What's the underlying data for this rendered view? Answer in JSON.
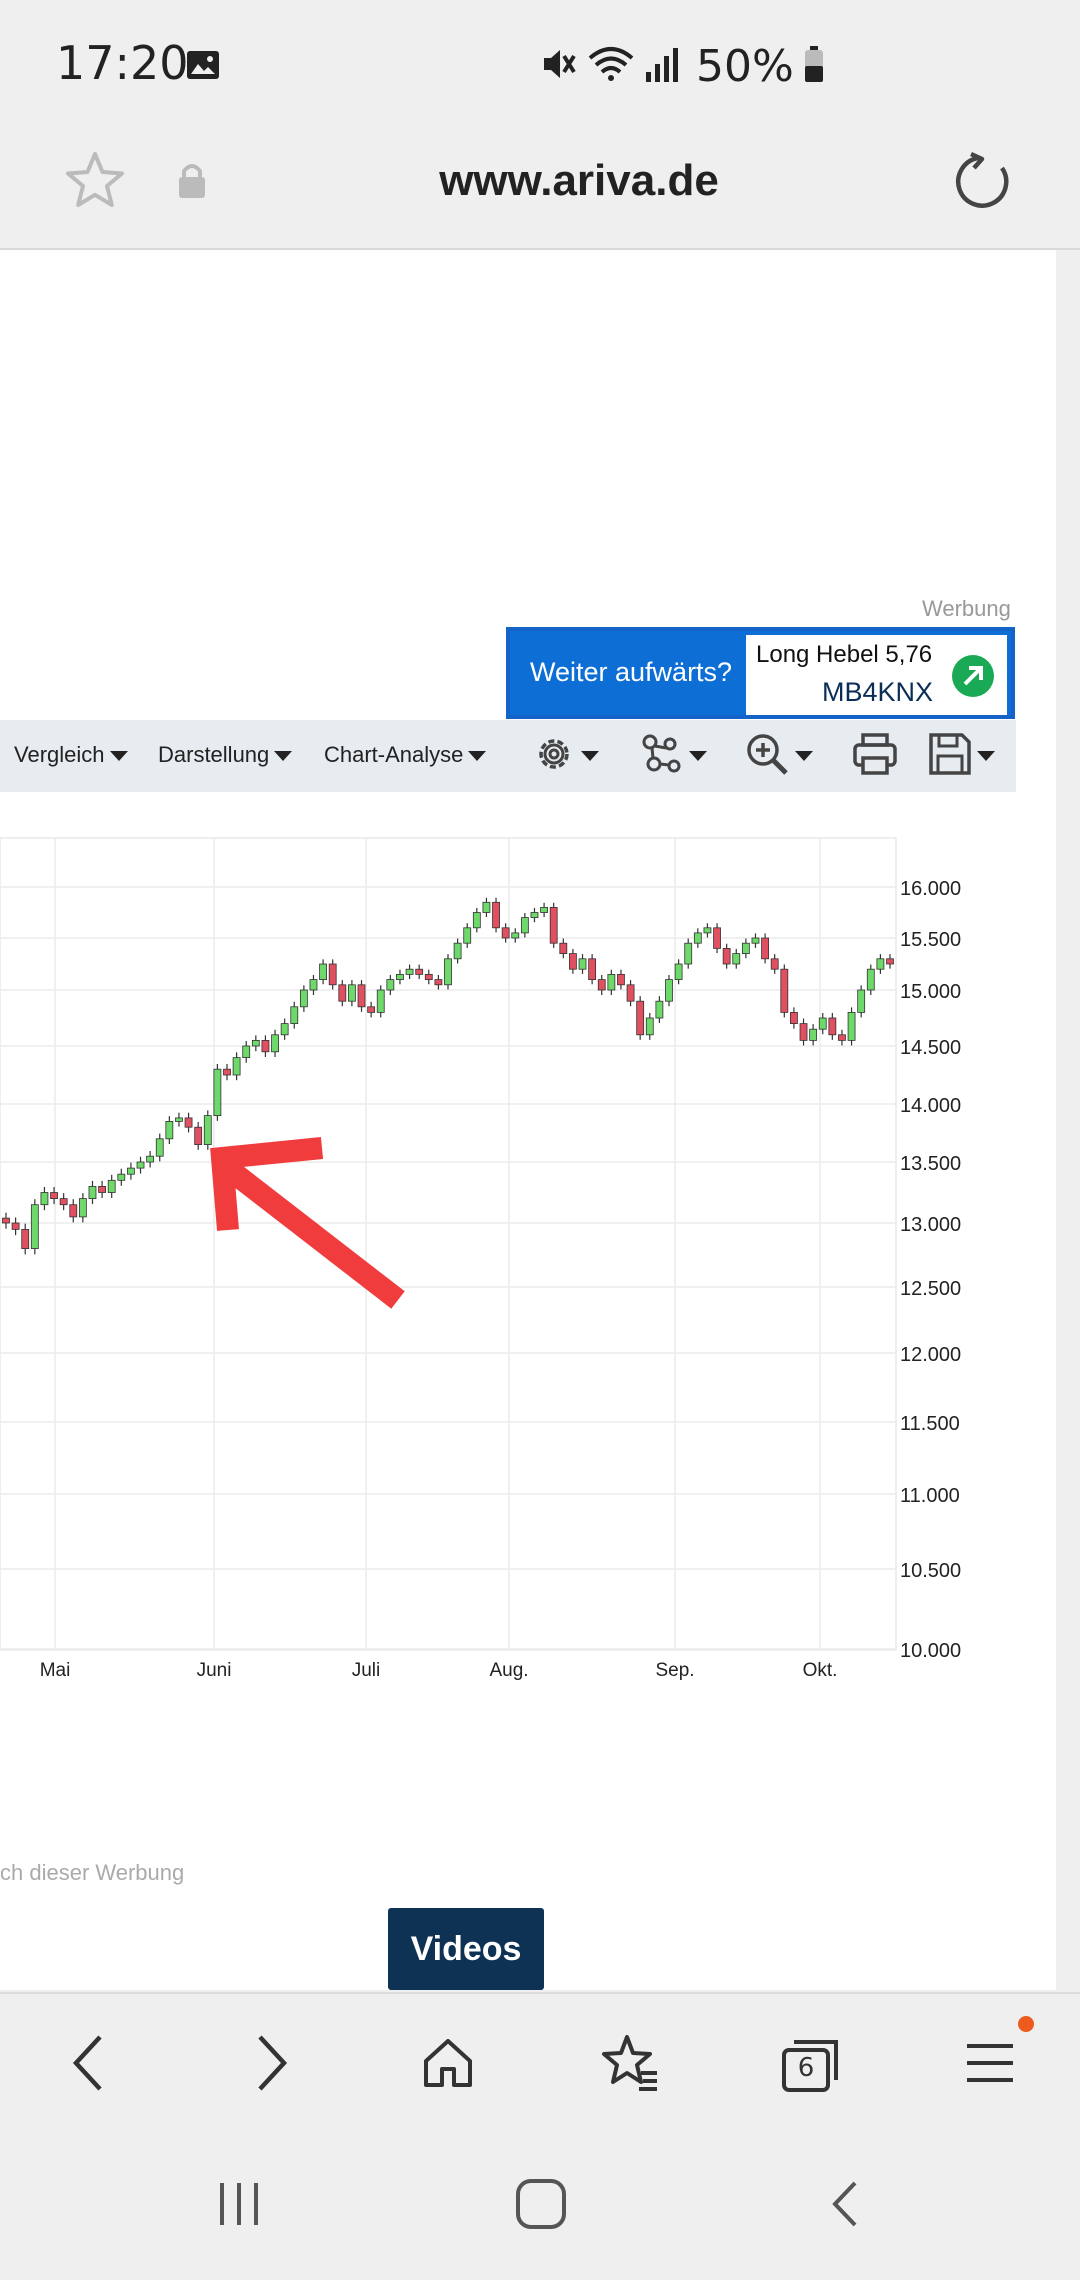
{
  "status_bar": {
    "time": "17:20",
    "battery": "50%",
    "icons": [
      "image-icon",
      "mute-icon",
      "wifi-icon",
      "signal-icon",
      "battery-icon"
    ]
  },
  "url_bar": {
    "url": "www.ariva.de",
    "icons": [
      "star-icon",
      "lock-icon",
      "reload-icon"
    ]
  },
  "ad": {
    "label": "Werbung",
    "cta": "Weiter aufwärts?",
    "product": "Long Hebel 5,76",
    "code": "MB4KNX",
    "accent": "#0d6fd6",
    "arrow_color": "#1aaa55"
  },
  "toolbar": {
    "menus": [
      "Vergleich",
      "Darstellung",
      "Chart-Analyse"
    ],
    "icons": [
      "settings-icon",
      "indicators-icon",
      "zoom-icon",
      "print-icon",
      "save-icon"
    ]
  },
  "chart_data": {
    "type": "candlestick",
    "y_ticks": [
      "16.000",
      "15.500",
      "15.000",
      "14.500",
      "14.000",
      "13.500",
      "13.000",
      "12.500",
      "12.000",
      "11.500",
      "11.000",
      "10.500",
      "10.000"
    ],
    "x_labels": [
      "Mai",
      "Juni",
      "Juli",
      "Aug.",
      "Sep.",
      "Okt."
    ],
    "ylim": [
      10000,
      16000
    ],
    "grid": true,
    "up_color": "#6fd86a",
    "down_color": "#e05060",
    "approx_close_series": [
      13000,
      12950,
      12800,
      13150,
      13250,
      13200,
      13150,
      13050,
      13200,
      13300,
      13250,
      13350,
      13400,
      13450,
      13500,
      13550,
      13700,
      13850,
      13880,
      13800,
      13650,
      13900,
      14300,
      14250,
      14400,
      14500,
      14550,
      14450,
      14600,
      14700,
      14850,
      15000,
      15100,
      15250,
      15050,
      14900,
      15050,
      14850,
      14800,
      15000,
      15100,
      15150,
      15200,
      15150,
      15100,
      15050,
      15300,
      15450,
      15600,
      15750,
      15850,
      15600,
      15500,
      15550,
      15700,
      15750,
      15800,
      15450,
      15350,
      15200,
      15300,
      15100,
      15000,
      15150,
      15050,
      14900,
      14600,
      14750,
      14900,
      15100,
      15250,
      15450,
      15550,
      15600,
      15400,
      15250,
      15350,
      15450,
      15500,
      15300,
      15200,
      14800,
      14700,
      14550,
      14650,
      14750,
      14600,
      14550,
      14800,
      15000,
      15200,
      15300,
      15250
    ]
  },
  "annotation": {
    "arrow_color": "#f03c3c"
  },
  "footer": {
    "ad_note": "ch dieser Werbung",
    "videos_button": "Videos"
  },
  "browser_nav": {
    "tab_count": "6",
    "icons": [
      "back-icon",
      "forward-icon",
      "home-icon",
      "bookmarks-icon",
      "tabs-icon",
      "menu-icon"
    ],
    "notification_color": "#ef5b1e"
  },
  "system_nav": {
    "icons": [
      "recents-icon",
      "home-button-icon",
      "back-icon"
    ]
  }
}
